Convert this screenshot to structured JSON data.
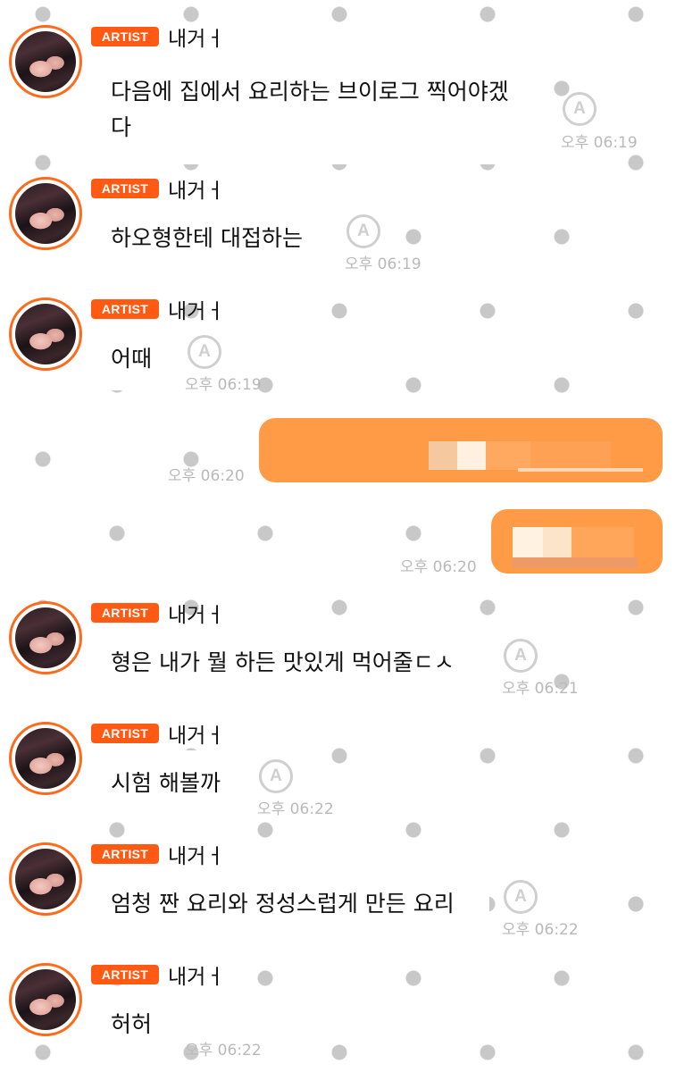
{
  "artist_label": "ARTIST",
  "sender_name": "내거ㅓ",
  "translate_icon_label": "A",
  "colors": {
    "accent": "#ff5a14",
    "outgoing_bubble": "#ff9b47",
    "timestamp": "#b9b9b9",
    "dot": "#c8c8c8"
  },
  "messages": [
    {
      "type": "incoming",
      "text": "다음에 집에서 요리하는 브이로그 찍어야겠\n다",
      "time": "오후 06:19"
    },
    {
      "type": "incoming",
      "text": "하오형한테 대접하는",
      "time": "오후 06:19"
    },
    {
      "type": "incoming",
      "text": "어때",
      "time": "오후 06:19"
    },
    {
      "type": "outgoing",
      "text": "",
      "time": "오후 06:20"
    },
    {
      "type": "outgoing",
      "text": "",
      "time": "오후 06:20"
    },
    {
      "type": "incoming",
      "text": "형은 내가 뭘 하든 맛있게 먹어줄ㄷㅅ",
      "time": "오후 06:21"
    },
    {
      "type": "incoming",
      "text": "시험 해볼까",
      "time": "오후 06:22"
    },
    {
      "type": "incoming",
      "text": "엄청 짠 요리와 정성스럽게 만든 요리",
      "time": "오후 06:22"
    },
    {
      "type": "incoming",
      "text": "허허",
      "time": "오후 06:22"
    }
  ]
}
